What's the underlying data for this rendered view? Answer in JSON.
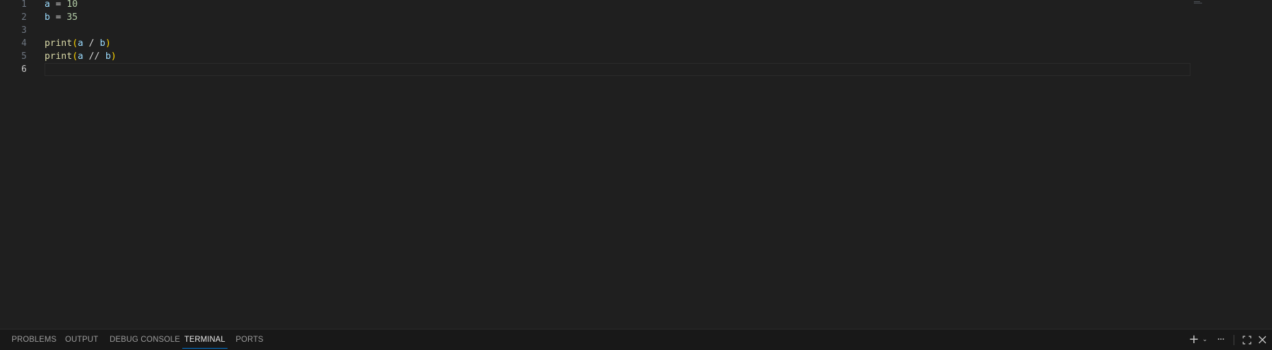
{
  "editor": {
    "lines": [
      {
        "number": "1",
        "tokens": [
          {
            "t": "a",
            "c": "var"
          },
          {
            "t": " = ",
            "c": "op"
          },
          {
            "t": "10",
            "c": "num"
          }
        ]
      },
      {
        "number": "2",
        "tokens": [
          {
            "t": "b",
            "c": "var"
          },
          {
            "t": " = ",
            "c": "op"
          },
          {
            "t": "35",
            "c": "num"
          }
        ]
      },
      {
        "number": "3",
        "tokens": []
      },
      {
        "number": "4",
        "tokens": [
          {
            "t": "print",
            "c": "fn"
          },
          {
            "t": "(",
            "c": "par"
          },
          {
            "t": "a",
            "c": "var"
          },
          {
            "t": " / ",
            "c": "op"
          },
          {
            "t": "b",
            "c": "var"
          },
          {
            "t": ")",
            "c": "par"
          }
        ]
      },
      {
        "number": "5",
        "tokens": [
          {
            "t": "print",
            "c": "fn"
          },
          {
            "t": "(",
            "c": "par"
          },
          {
            "t": "a",
            "c": "var"
          },
          {
            "t": " // ",
            "c": "op"
          },
          {
            "t": "b",
            "c": "var"
          },
          {
            "t": ")",
            "c": "par"
          }
        ]
      },
      {
        "number": "6",
        "tokens": []
      }
    ],
    "active_line": "6"
  },
  "panel": {
    "tabs": [
      {
        "label": "PROBLEMS",
        "active": false
      },
      {
        "label": "OUTPUT",
        "active": false
      },
      {
        "label": "DEBUG CONSOLE",
        "active": false
      },
      {
        "label": "TERMINAL",
        "active": true
      },
      {
        "label": "PORTS",
        "active": false
      }
    ],
    "toolbar": {
      "new_terminal_icon": "plus-icon",
      "launch_profile_icon": "chevron-down-icon",
      "more_actions_icon": "ellipsis-icon",
      "maximize_icon": "maximize-icon",
      "close_icon": "close-icon"
    }
  },
  "colors": {
    "editor_bg": "#1f1f1f",
    "panel_bg": "#181818",
    "accent": "#0078d4",
    "variable": "#9cdcfe",
    "number": "#b5cea8",
    "function": "#dcdcaa",
    "bracket": "#ffd700"
  }
}
